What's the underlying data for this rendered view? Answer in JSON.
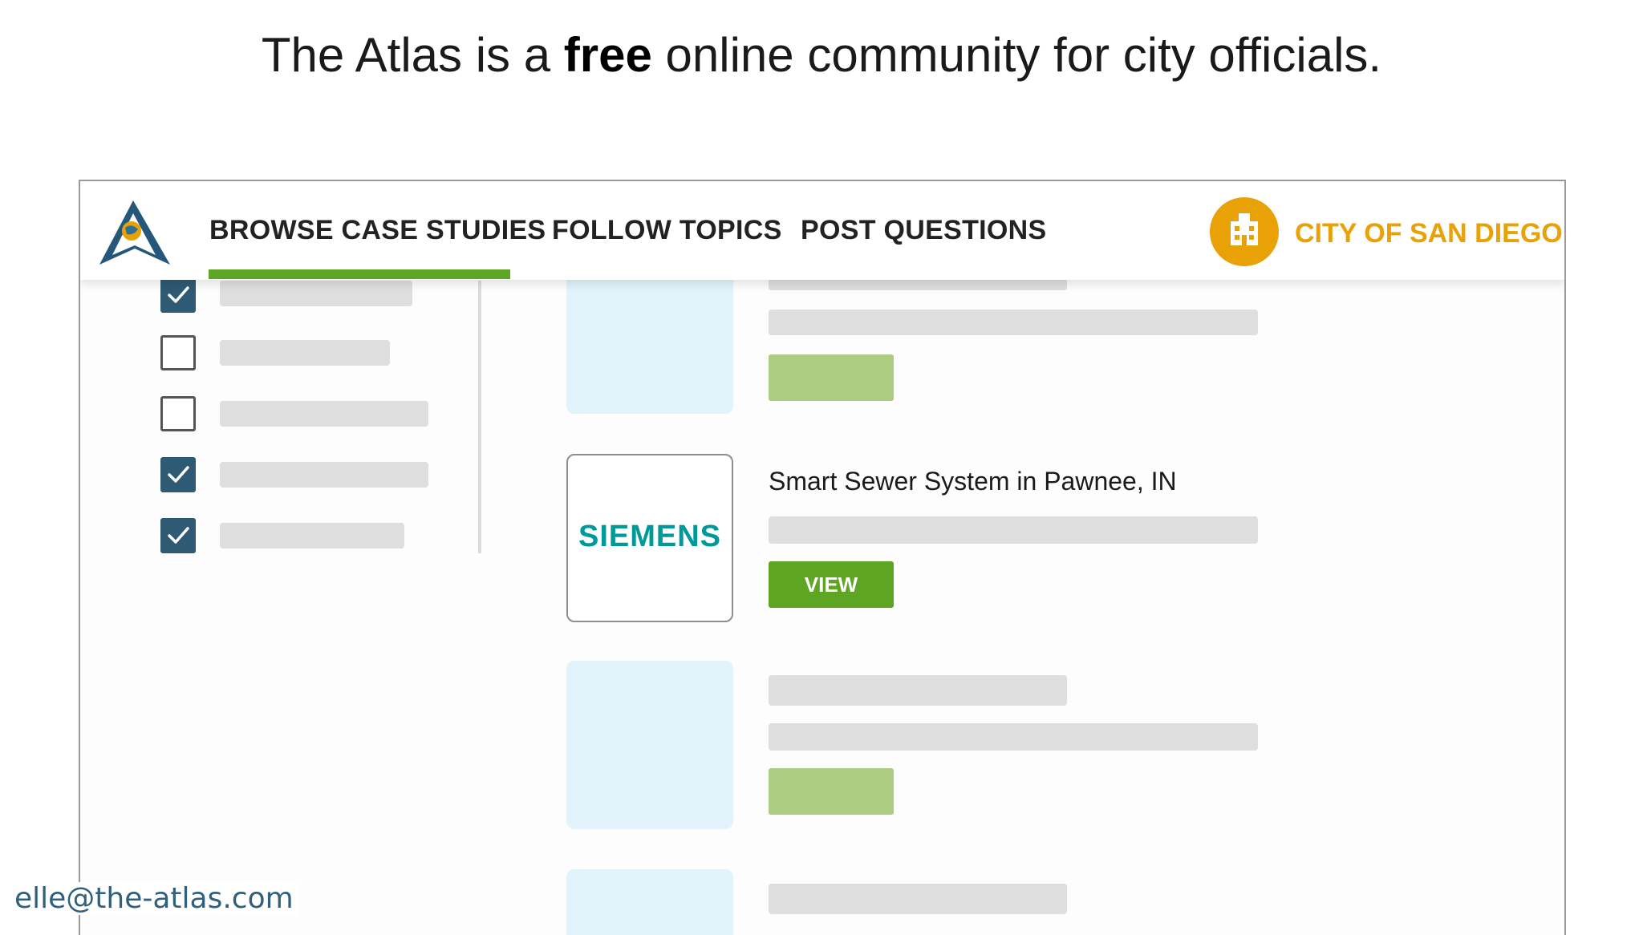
{
  "headline": {
    "before": "The Atlas is a ",
    "emphasis": "free",
    "after": " online community for city officials."
  },
  "nav": {
    "tabs": [
      {
        "label": "BROWSE CASE STUDIES",
        "active": true
      },
      {
        "label": "FOLLOW TOPICS",
        "active": false
      },
      {
        "label": "POST QUESTIONS",
        "active": false
      }
    ],
    "city": "CITY OF SAN DIEGO",
    "city_icon": "city-buildings-icon",
    "logo_icon": "atlas-logo-icon"
  },
  "filters": [
    {
      "checked": true
    },
    {
      "checked": false
    },
    {
      "checked": false
    },
    {
      "checked": true
    },
    {
      "checked": true
    }
  ],
  "case_study": {
    "title": "Smart Sewer System in Pawnee, IN",
    "logo_text": "SIEMENS",
    "button": "VIEW"
  },
  "footer": {
    "email": "elle@the-atlas.com"
  },
  "colors": {
    "accent_green": "#5ea523",
    "city_orange": "#e8a106",
    "checkbox_blue": "#2f5a73",
    "siemens_teal": "#009999"
  }
}
